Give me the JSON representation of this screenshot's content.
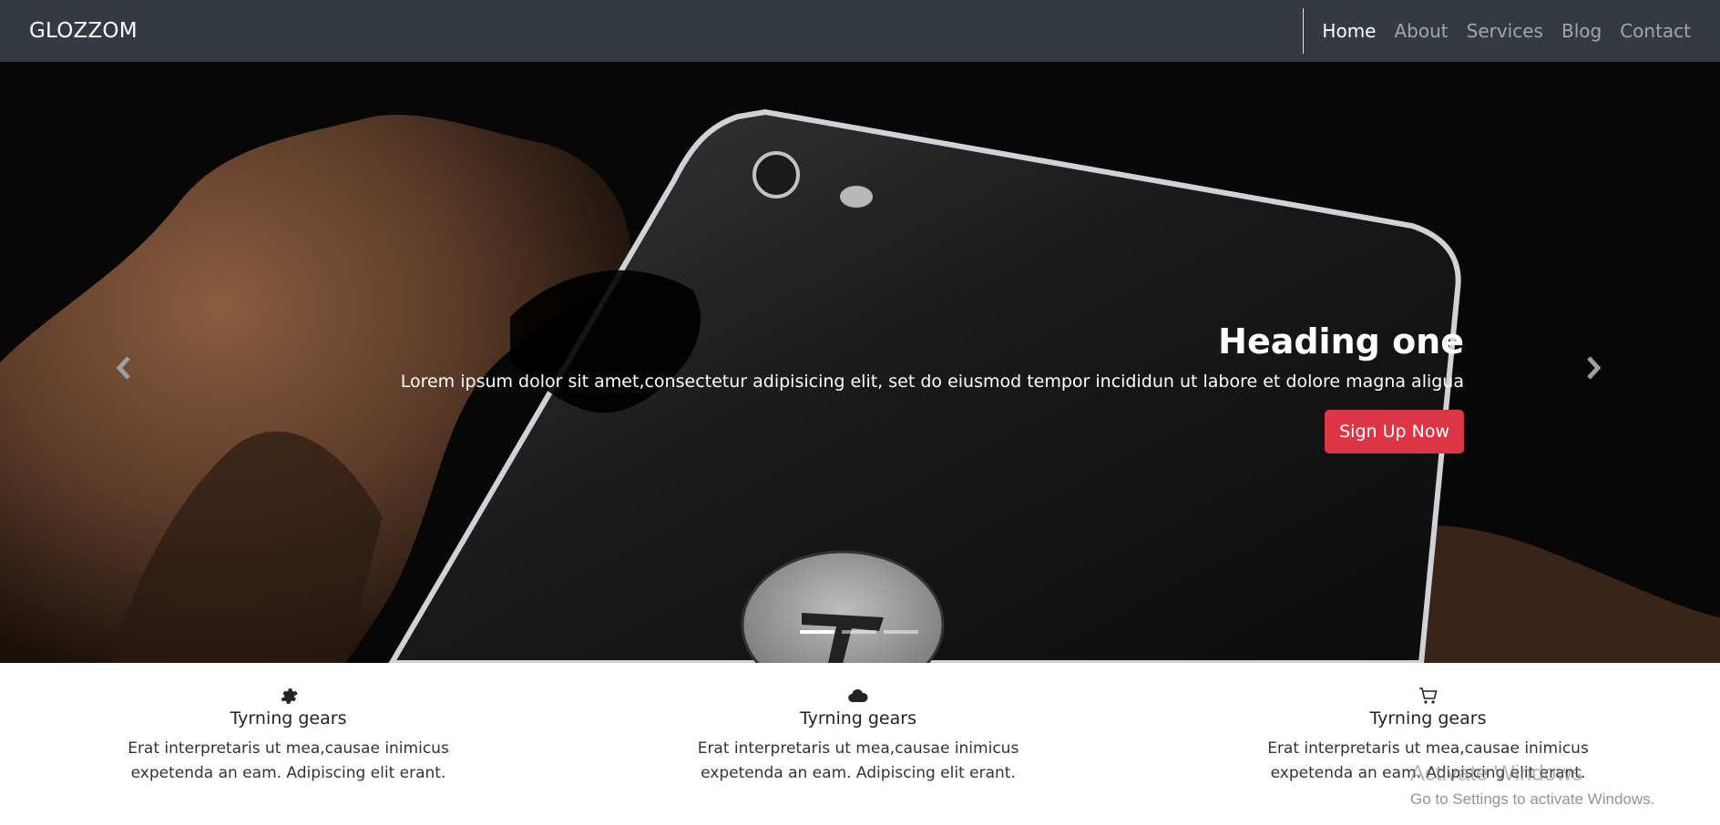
{
  "brand": "GLOZZOM",
  "nav": {
    "items": [
      {
        "label": "Home",
        "active": true
      },
      {
        "label": "About"
      },
      {
        "label": "Services"
      },
      {
        "label": "Blog"
      },
      {
        "label": "Contact"
      }
    ]
  },
  "hero": {
    "heading": "Heading one",
    "text": "Lorem ipsum dolor sit amet,consectetur adipisicing elit, set do eiusmod tempor incididun ut labore et dolore magna aligua",
    "button_label": "Sign Up Now",
    "prev_icon": "chevron-left-icon",
    "next_icon": "chevron-right-icon",
    "slide_count": 3,
    "active_slide": 1
  },
  "features": [
    {
      "icon": "gear-icon",
      "title": "Tyrning gears",
      "text": "Erat interpretaris ut mea,causae inimicus expetenda an eam. Adipiscing elit erant."
    },
    {
      "icon": "cloud-icon",
      "title": "Tyrning gears",
      "text": "Erat interpretaris ut mea,causae inimicus expetenda an eam. Adipiscing elit erant."
    },
    {
      "icon": "cart-icon",
      "title": "Tyrning gears",
      "text": "Erat interpretaris ut mea,causae inimicus expetenda an eam. Adipiscing elit erant."
    }
  ],
  "os_overlay": {
    "title": "Activate Windows",
    "subtitle": "Go to Settings to activate Windows."
  },
  "colors": {
    "navbar": "#343a40",
    "button": "#dc3545"
  }
}
